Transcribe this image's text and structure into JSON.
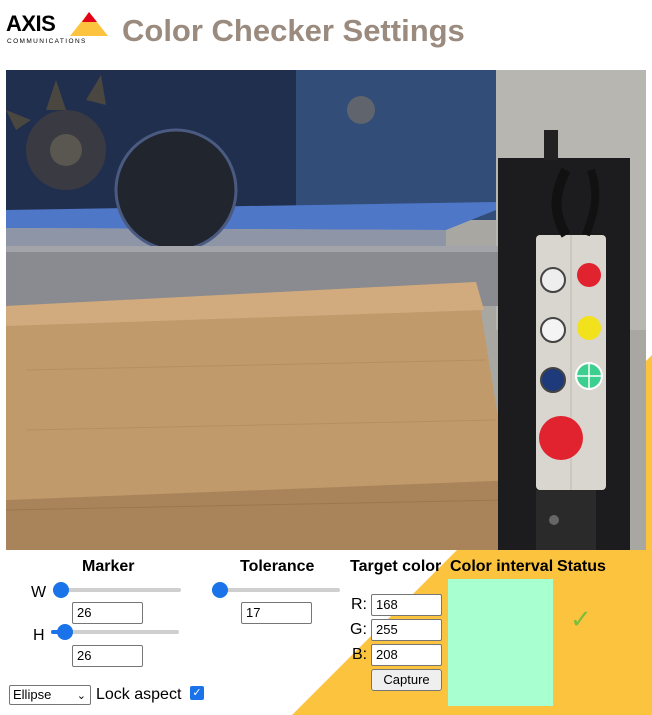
{
  "header": {
    "logo_text": "AXIS",
    "logo_subtext": "COMMUNICATIONS",
    "title": "Color Checker Settings"
  },
  "colors": {
    "title": "#9a8b7e",
    "accent": "#1a73e8",
    "background_triangle": "#fcc43e",
    "status_ok": "#7cbd3a",
    "interval_swatch": "#a8ffd0"
  },
  "marker": {
    "heading": "Marker",
    "width_label": "W",
    "width_value": "26",
    "width_slider_fraction": 0.06,
    "height_label": "H",
    "height_value": "26",
    "height_slider_fraction": 0.08,
    "shape": "Ellipse",
    "lock_label": "Lock aspect",
    "lock_checked": true
  },
  "tolerance": {
    "heading": "Tolerance",
    "value": "17",
    "slider_fraction": 0.06
  },
  "target": {
    "heading": "Target color",
    "r_label": "R:",
    "r_value": "168",
    "g_label": "G:",
    "g_value": "255",
    "b_label": "B:",
    "b_value": "208",
    "capture_label": "Capture"
  },
  "interval": {
    "heading": "Color interval"
  },
  "status": {
    "heading": "Status",
    "icon": "check-icon",
    "glyph": "✓"
  }
}
